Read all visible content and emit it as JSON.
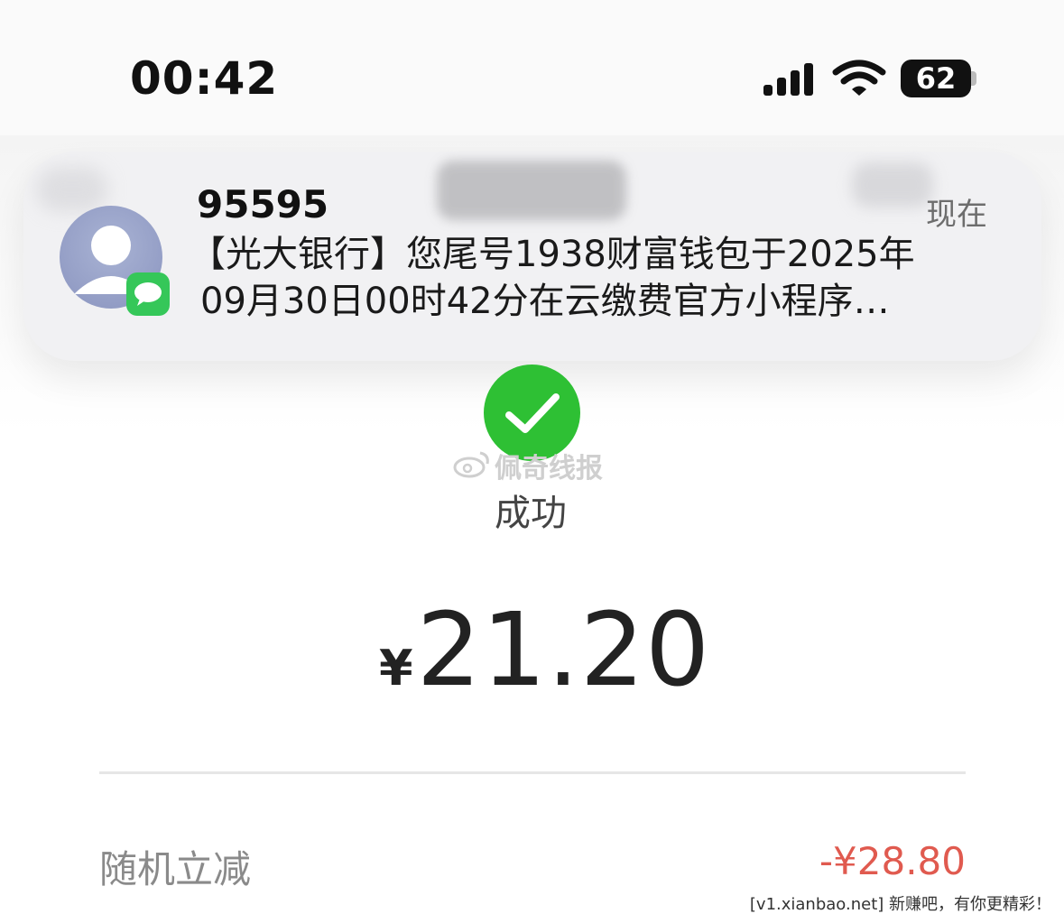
{
  "status_bar": {
    "time": "00:42",
    "battery": "62"
  },
  "notification": {
    "sender": "95595",
    "time": "现在",
    "message_line1": "【光大银行】您尾号1938财富钱包于2025年",
    "message_line2": "09月30日00时42分在云缴费官方小程序…",
    "icon_color": "#35c759"
  },
  "watermark": {
    "text": "佩奇线报"
  },
  "payment": {
    "status": "成功",
    "currency": "¥",
    "amount": "21.20",
    "success_color": "#2ec034"
  },
  "details": {
    "discount_label": "随机立减",
    "discount_value": "-¥28.80",
    "discount_color": "#e05a4f"
  },
  "footer": {
    "text": "[v1.xianbao.net] 新赚吧，有你更精彩！"
  }
}
